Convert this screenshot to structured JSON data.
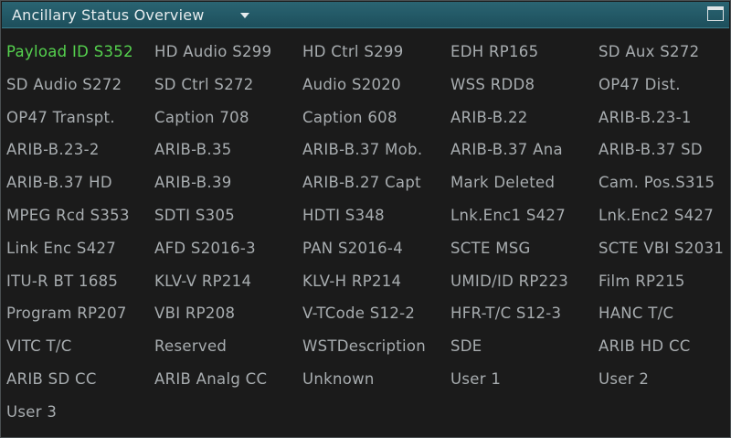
{
  "window": {
    "title": "Ancillary Status Overview"
  },
  "colors": {
    "title_bar": "#1f5563",
    "active_text": "#55d24e",
    "inactive_text": "#a8adb0",
    "background": "#1b1b1b"
  },
  "icons": {
    "dropdown": "dropdown-arrow-icon",
    "maximize": "maximize-icon"
  },
  "items": [
    {
      "label": "Payload ID S352",
      "active": true
    },
    {
      "label": "HD Audio S299",
      "active": false
    },
    {
      "label": "HD Ctrl S299",
      "active": false
    },
    {
      "label": "EDH RP165",
      "active": false
    },
    {
      "label": "SD Aux S272",
      "active": false
    },
    {
      "label": "SD Audio S272",
      "active": false
    },
    {
      "label": "SD Ctrl S272",
      "active": false
    },
    {
      "label": "Audio S2020",
      "active": false
    },
    {
      "label": "WSS RDD8",
      "active": false
    },
    {
      "label": "OP47 Dist.",
      "active": false
    },
    {
      "label": "OP47 Transpt.",
      "active": false
    },
    {
      "label": "Caption 708",
      "active": false
    },
    {
      "label": "Caption 608",
      "active": false
    },
    {
      "label": "ARIB-B.22",
      "active": false
    },
    {
      "label": "ARIB-B.23-1",
      "active": false
    },
    {
      "label": "ARIB-B.23-2",
      "active": false
    },
    {
      "label": "ARIB-B.35",
      "active": false
    },
    {
      "label": "ARIB-B.37 Mob.",
      "active": false
    },
    {
      "label": "ARIB-B.37 Ana",
      "active": false
    },
    {
      "label": "ARIB-B.37 SD",
      "active": false
    },
    {
      "label": "ARIB-B.37 HD",
      "active": false
    },
    {
      "label": "ARIB-B.39",
      "active": false
    },
    {
      "label": "ARIB-B.27 Capt",
      "active": false
    },
    {
      "label": "Mark Deleted",
      "active": false
    },
    {
      "label": "Cam. Pos.S315",
      "active": false
    },
    {
      "label": "MPEG Rcd S353",
      "active": false
    },
    {
      "label": "SDTI S305",
      "active": false
    },
    {
      "label": "HDTI S348",
      "active": false
    },
    {
      "label": "Lnk.Enc1 S427",
      "active": false
    },
    {
      "label": "Lnk.Enc2 S427",
      "active": false
    },
    {
      "label": "Link Enc S427",
      "active": false
    },
    {
      "label": "AFD S2016-3",
      "active": false
    },
    {
      "label": "PAN S2016-4",
      "active": false
    },
    {
      "label": "SCTE MSG",
      "active": false
    },
    {
      "label": "SCTE VBI S2031",
      "active": false
    },
    {
      "label": "ITU-R BT 1685",
      "active": false
    },
    {
      "label": "KLV-V RP214",
      "active": false
    },
    {
      "label": "KLV-H RP214",
      "active": false
    },
    {
      "label": "UMID/ID RP223",
      "active": false
    },
    {
      "label": "Film RP215",
      "active": false
    },
    {
      "label": "Program RP207",
      "active": false
    },
    {
      "label": "VBI RP208",
      "active": false
    },
    {
      "label": "V-TCode S12-2",
      "active": false
    },
    {
      "label": "HFR-T/C S12-3",
      "active": false
    },
    {
      "label": "HANC T/C",
      "active": false
    },
    {
      "label": "VITC T/C",
      "active": false
    },
    {
      "label": "Reserved",
      "active": false
    },
    {
      "label": "WSTDescription",
      "active": false
    },
    {
      "label": "SDE",
      "active": false
    },
    {
      "label": "ARIB HD CC",
      "active": false
    },
    {
      "label": "ARIB SD CC",
      "active": false
    },
    {
      "label": "ARIB Analg CC",
      "active": false
    },
    {
      "label": "Unknown",
      "active": false
    },
    {
      "label": "User 1",
      "active": false
    },
    {
      "label": "User 2",
      "active": false
    },
    {
      "label": "User 3",
      "active": false
    }
  ]
}
